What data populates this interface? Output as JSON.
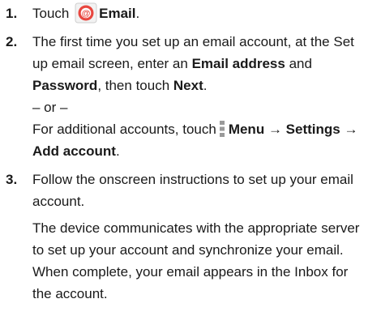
{
  "steps": [
    {
      "number": "1.",
      "text_before": "Touch",
      "app_name": "Email",
      "text_after": ".",
      "icon": "email-app-icon"
    },
    {
      "number": "2.",
      "line1": "The first time you set up an email account, at the Set",
      "line2_a": "up email screen, enter an ",
      "line2_bold": "Email address",
      "line2_b": " and",
      "line3_bold_a": "Password",
      "line3_a": ", then touch ",
      "line3_bold_b": "Next",
      "line3_b": ".",
      "or_text": "– or –",
      "line5_a": "For additional accounts, touch",
      "menu_label": "Menu",
      "arrow": "→",
      "settings_label": "Settings",
      "add_account_label": "Add account",
      "line6_end": ".",
      "icon": "menu-icon"
    },
    {
      "number": "3.",
      "line1": "Follow the onscreen instructions to set up your email",
      "line2": "account.",
      "p2_line1": "The device communicates with the appropriate server",
      "p2_line2": "to set up your account and synchronize your email.",
      "p2_line3": "When complete, your email appears in the Inbox for",
      "p2_line4": "the account."
    }
  ],
  "colors": {
    "text": "#1a1a1a",
    "icon_outer": "#e8473f",
    "icon_inner": "#ffffff",
    "menu_icon": "#9a9a9a"
  }
}
